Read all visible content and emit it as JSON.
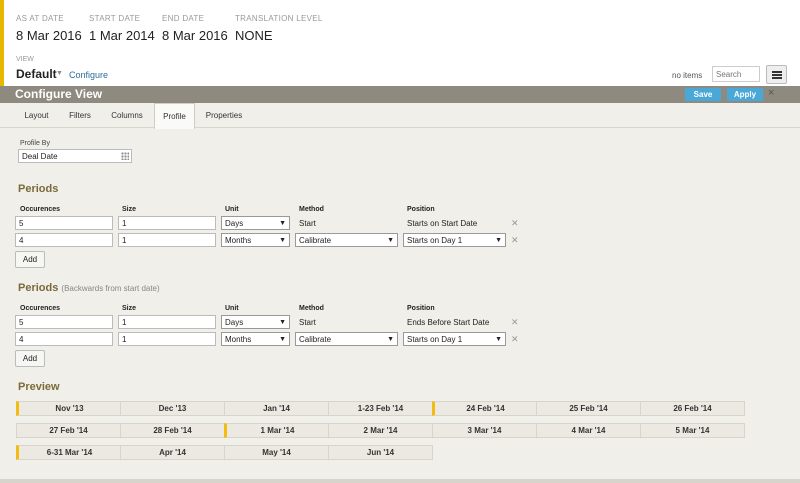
{
  "header": {
    "as_at_label": "AS AT DATE",
    "as_at_value": "8 Mar 2016",
    "start_label": "START DATE",
    "start_value": "1 Mar 2014",
    "end_label": "END DATE",
    "end_value": "8 Mar 2016",
    "translation_label": "TRANSLATION LEVEL",
    "translation_value": "NONE",
    "view_label": "VIEW",
    "view_name": "Default",
    "configure_link": "Configure",
    "no_items": "no items",
    "search_placeholder": "Search"
  },
  "config_bar": {
    "title": "Configure View",
    "save": "Save",
    "apply": "Apply",
    "close": "×"
  },
  "tabs": [
    "Layout",
    "Filters",
    "Columns",
    "Profile",
    "Properties"
  ],
  "active_tab": "Profile",
  "profile": {
    "label": "Profile By",
    "value": "Deal Date"
  },
  "periods1": {
    "title": "Periods",
    "headers": {
      "occ": "Occurences",
      "size": "Size",
      "unit": "Unit",
      "method": "Method",
      "position": "Position"
    },
    "rows": [
      {
        "occ": "5",
        "size": "1",
        "unit": "Days",
        "method": "Start",
        "position": "Starts on Start Date"
      },
      {
        "occ": "4",
        "size": "1",
        "unit": "Months",
        "method": "Calibrate",
        "position": "Starts on Day 1"
      }
    ],
    "add": "Add"
  },
  "periods2": {
    "title": "Periods",
    "subtitle": "(Backwards from start date)",
    "headers": {
      "occ": "Occurences",
      "size": "Size",
      "unit": "Unit",
      "method": "Method",
      "position": "Position"
    },
    "rows": [
      {
        "occ": "5",
        "size": "1",
        "unit": "Days",
        "method": "Start",
        "position": "Ends Before Start Date"
      },
      {
        "occ": "4",
        "size": "1",
        "unit": "Months",
        "method": "Calibrate",
        "position": "Starts on Day 1"
      }
    ],
    "add": "Add"
  },
  "preview": {
    "title": "Preview",
    "rows": [
      [
        "Nov '13",
        "Dec '13",
        "Jan '14",
        "1-23 Feb '14",
        "24 Feb '14",
        "25 Feb '14",
        "26 Feb '14"
      ],
      [
        "27 Feb '14",
        "28 Feb '14",
        "1 Mar '14",
        "2 Mar '14",
        "3 Mar '14",
        "4 Mar '14",
        "5 Mar '14"
      ],
      [
        "6-31 Mar '14",
        "Apr '14",
        "May '14",
        "Jun '14"
      ]
    ]
  }
}
